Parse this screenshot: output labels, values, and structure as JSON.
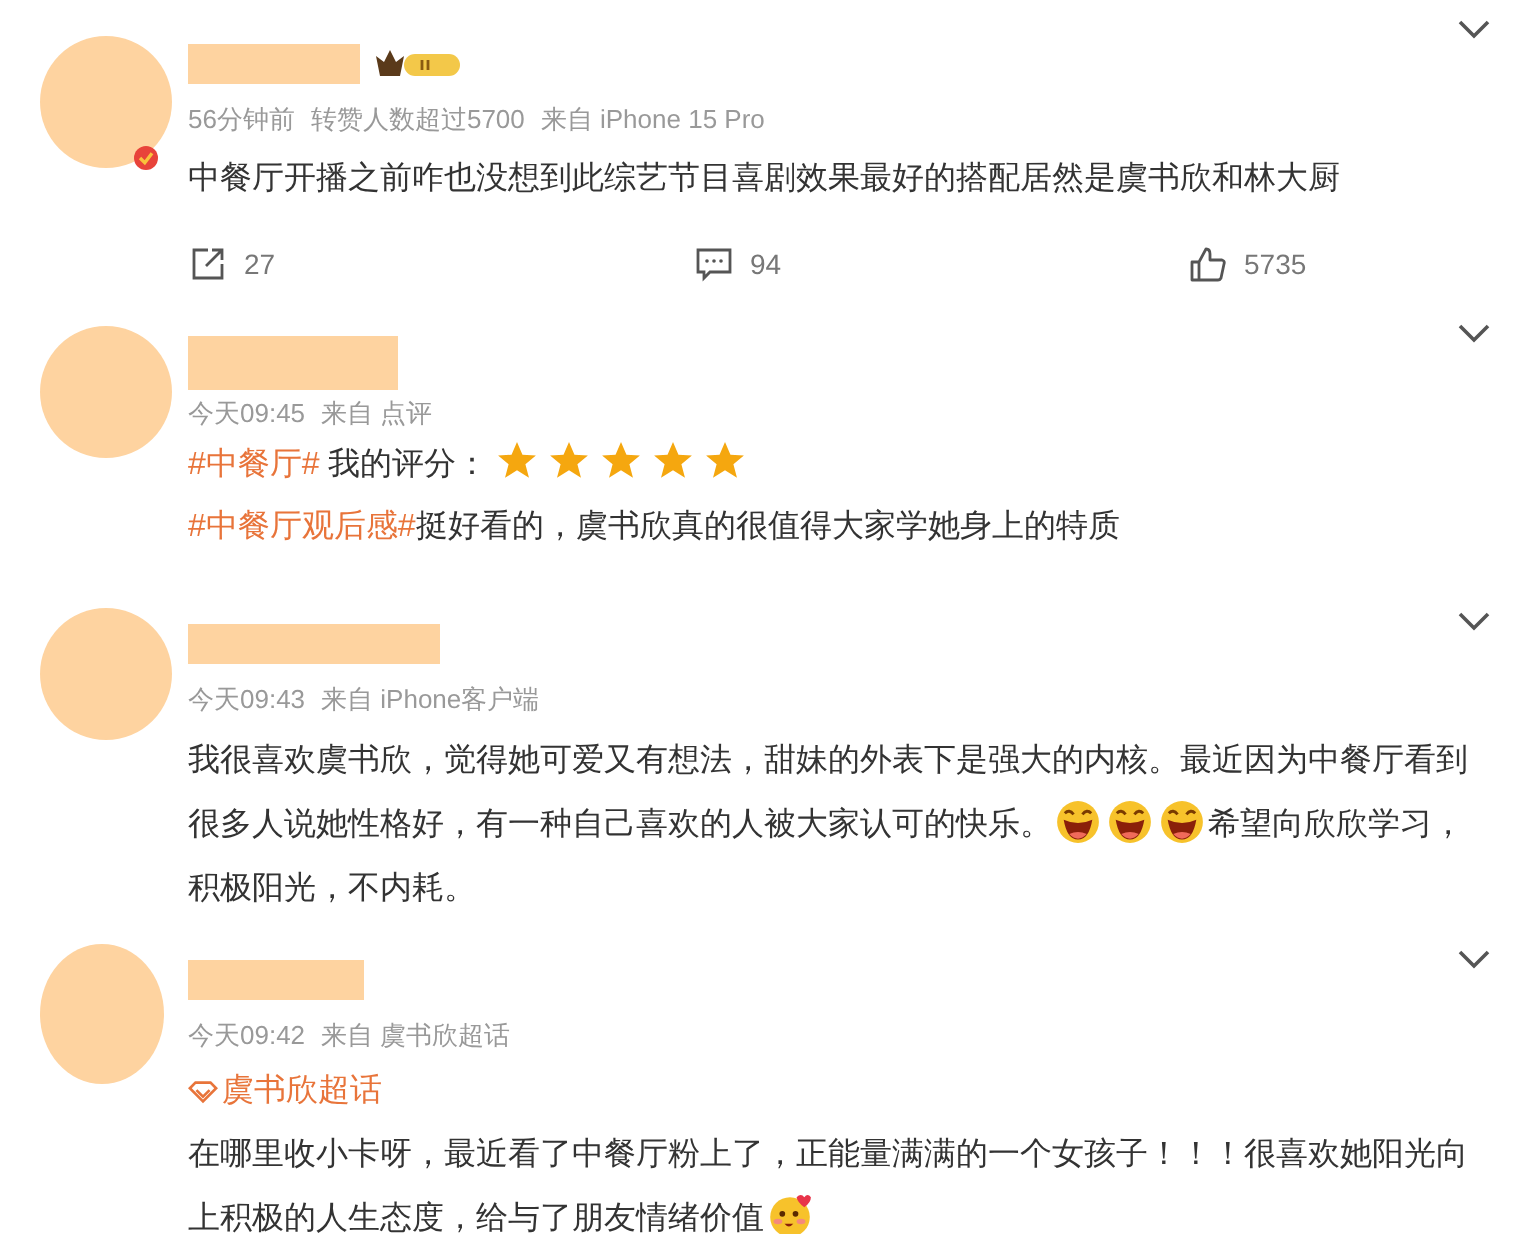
{
  "comments": [
    {
      "badge": true,
      "meta": [
        "56分钟前",
        "转赞人数超过5700",
        "来自 iPhone 15 Pro"
      ],
      "lines": [
        [
          {
            "kind": "text",
            "text": "中餐厅开播之前咋也没想到此综艺节目喜剧效果最好的搭配居然是虞书欣和林大厨"
          }
        ]
      ],
      "actions": [
        {
          "kind": "share",
          "count": "27"
        },
        {
          "kind": "comment",
          "count": "94"
        },
        {
          "kind": "like",
          "count": "5735"
        }
      ]
    },
    {
      "badge": false,
      "meta": [
        "今天09:45",
        "来自 点评"
      ],
      "lines": [
        [
          {
            "kind": "tag",
            "text": "#中餐厅#"
          },
          {
            "kind": "text",
            "text": " 我的评分："
          },
          {
            "kind": "rating",
            "stars": 5
          }
        ],
        [
          {
            "kind": "tag",
            "text": "#中餐厅观后感#"
          },
          {
            "kind": "text",
            "text": "挺好看的，虞书欣真的很值得大家学她身上的特质"
          }
        ]
      ]
    },
    {
      "badge": false,
      "meta": [
        "今天09:43",
        "来自 iPhone客户端"
      ],
      "lines": [
        [
          {
            "kind": "text",
            "text": "我很喜欢虞书欣，觉得她可爱又有想法，甜妹的外表下是强大的内核。最近因为中餐厅看到很多人说她性格好，有一种自己喜欢的人被大家认可的快乐。"
          },
          {
            "kind": "laugh_emoji"
          },
          {
            "kind": "laugh_emoji"
          },
          {
            "kind": "laugh_emoji"
          },
          {
            "kind": "text",
            "text": "希望向欣欣学习，积极阳光，不内耗。"
          }
        ]
      ]
    },
    {
      "badge": false,
      "meta": [
        "今天09:42",
        "来自 虞书欣超话"
      ],
      "topic": "虞书欣超话",
      "lines": [
        [
          {
            "kind": "text",
            "text": "在哪里收小卡呀，最近看了中餐厅粉上了，正能量满满的一个女孩子！！！很喜欢她阳光向上积极的人生态度，给与了朋友情绪价值"
          },
          {
            "kind": "blush_emoji"
          }
        ]
      ]
    }
  ]
}
